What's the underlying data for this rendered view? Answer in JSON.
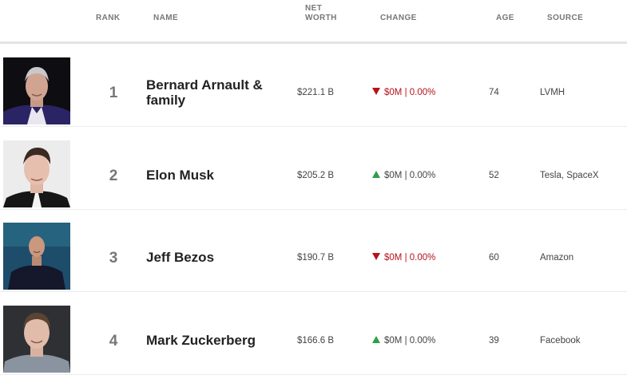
{
  "table": {
    "headers": {
      "rank": "RANK",
      "name": "NAME",
      "net_worth": "NET WORTH",
      "change": "CHANGE",
      "age": "AGE",
      "source": "SOURCE"
    },
    "rows": [
      {
        "rank": "1",
        "name": "Bernard Arnault & family",
        "net_worth": "$221.1 B",
        "change": "$0M | 0.00%",
        "change_direction": "down",
        "change_icon": "triangle-down-icon",
        "age": "74",
        "source": "LVMH"
      },
      {
        "rank": "2",
        "name": "Elon Musk",
        "net_worth": "$205.2 B",
        "change": "$0M | 0.00%",
        "change_direction": "up",
        "change_icon": "triangle-up-icon",
        "age": "52",
        "source": "Tesla, SpaceX"
      },
      {
        "rank": "3",
        "name": "Jeff Bezos",
        "net_worth": "$190.7 B",
        "change": "$0M | 0.00%",
        "change_direction": "down",
        "change_icon": "triangle-down-icon",
        "age": "60",
        "source": "Amazon"
      },
      {
        "rank": "4",
        "name": "Mark Zuckerberg",
        "net_worth": "$166.6 B",
        "change": "$0M | 0.00%",
        "change_direction": "up",
        "change_icon": "triangle-up-icon",
        "age": "39",
        "source": "Facebook"
      }
    ]
  },
  "colors": {
    "change_down": "#b5121b",
    "change_up": "#2e9e4a"
  }
}
